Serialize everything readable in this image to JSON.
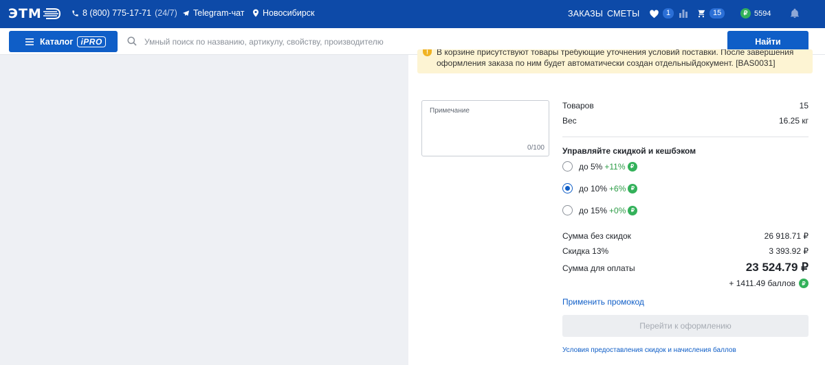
{
  "header": {
    "logo_text": "ЭТМ",
    "phone": "8 (800) 775-17-71",
    "phone_hours": "(24/7)",
    "telegram": "Telegram-чат",
    "city": "Новосибирск",
    "orders": "ЗАКАЗЫ",
    "estimates": "СМЕТЫ",
    "favorites_count": "1",
    "cart_count": "15",
    "bonus_points": "5594",
    "colors": {
      "bar": "#0d4aa8",
      "accent": "#0f5ec7",
      "green": "#2d9c47"
    }
  },
  "search": {
    "catalog_label": "Каталог",
    "catalog_badge": "iPRO",
    "placeholder": "Умный поиск по названию, артикулу, свойству, производителю",
    "find_label": "Найти"
  },
  "warning": {
    "text": "В корзине присутствуют товары требующие уточнения условий поставки. После завершения оформления заказа по ним будет автоматически создан отдельныйдокумент. [BAS0031]"
  },
  "note": {
    "label": "Примечание",
    "counter": "0/100"
  },
  "summary": {
    "items_label": "Товаров",
    "items_value": "15",
    "weight_label": "Вес",
    "weight_value": "16.25 кг",
    "discount_title": "Управляйте скидкой и кешбэком",
    "options": [
      {
        "discount": "до 5%",
        "cashback": "+11%",
        "selected": false
      },
      {
        "discount": "до 10%",
        "cashback": "+6%",
        "selected": true
      },
      {
        "discount": "до 15%",
        "cashback": "+0%",
        "selected": false
      }
    ],
    "subtotal_label": "Сумма без скидок",
    "subtotal_value": "26 918.71 ₽",
    "discount_label": "Скидка 13%",
    "discount_value": "3 393.92 ₽",
    "total_label": "Сумма для оплаты",
    "total_value": "23 524.79 ₽",
    "bonus_text": "+ 1411.49 баллов",
    "promo_link": "Применить промокод",
    "checkout_label": "Перейти к оформлению",
    "terms_link": "Условия предоставления скидок и начисления баллов"
  }
}
